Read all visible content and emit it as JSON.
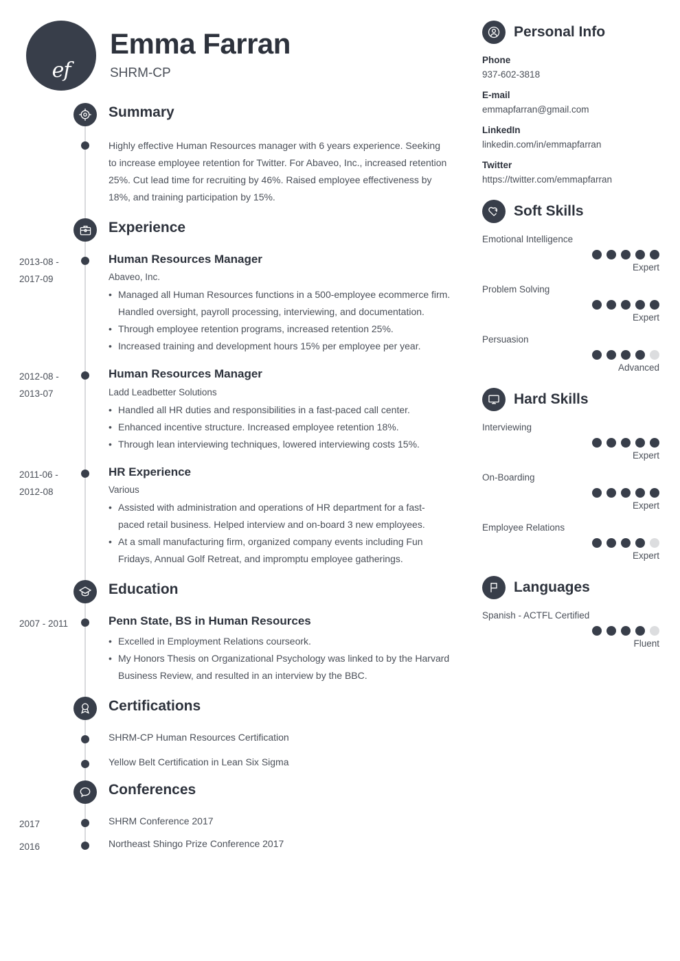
{
  "header": {
    "initials": "ef",
    "name": "Emma Farran",
    "subtitle": "SHRM-CP"
  },
  "sections": {
    "summary": {
      "title": "Summary",
      "icon": "target-icon",
      "text": "Highly effective Human Resources manager with 6 years experience. Seeking to increase employee retention for Twitter. For Abaveo, Inc., increased retention 25%. Cut lead time for recruiting by 46%. Raised employee effectiveness by 18%, and training participation by 15%."
    },
    "experience": {
      "title": "Experience",
      "icon": "briefcase-icon",
      "entries": [
        {
          "date": "2013-08 - 2017-09",
          "title": "Human Resources Manager",
          "org": "Abaveo, Inc.",
          "bullets": [
            "Managed all Human Resources functions in a 500-employee ecommerce firm. Handled oversight, payroll processing, interviewing, and documentation.",
            "Through employee retention programs, increased retention 25%.",
            "Increased training and development hours 15% per employee per year."
          ]
        },
        {
          "date": "2012-08 - 2013-07",
          "title": "Human Resources Manager",
          "org": "Ladd Leadbetter Solutions",
          "bullets": [
            "Handled all HR duties and responsibilities in a fast-paced call center.",
            "Enhanced incentive structure. Increased employee retention 18%.",
            "Through lean interviewing techniques, lowered interviewing costs 15%."
          ]
        },
        {
          "date": "2011-06 - 2012-08",
          "title": "HR Experience",
          "org": "Various",
          "bullets": [
            "Assisted with administration and operations of HR department for a fast-paced retail business. Helped interview and on-board 3 new employees.",
            "At a small manufacturing firm, organized company events including Fun Fridays, Annual Golf Retreat, and impromptu employee gatherings."
          ]
        }
      ]
    },
    "education": {
      "title": "Education",
      "icon": "graduation-cap-icon",
      "entries": [
        {
          "date": "2007 - 2011",
          "title": "Penn State, BS in Human Resources",
          "bullets": [
            "Excelled in Employment Relations courseork.",
            "My Honors Thesis on Organizational Psychology was linked to by the Harvard Business Review, and resulted in an interview by the BBC."
          ]
        }
      ]
    },
    "certifications": {
      "title": "Certifications",
      "icon": "award-ribbon-icon",
      "entries": [
        {
          "text": "SHRM-CP Human Resources Certification"
        },
        {
          "text": "Yellow Belt Certification in Lean Six Sigma"
        }
      ]
    },
    "conferences": {
      "title": "Conferences",
      "icon": "speech-bubble-icon",
      "entries": [
        {
          "date": "2017",
          "text": "SHRM Conference 2017"
        },
        {
          "date": "2016",
          "text": "Northeast Shingo Prize Conference 2017"
        }
      ]
    }
  },
  "sidebar": {
    "personal_info": {
      "title": "Personal Info",
      "icon": "person-icon",
      "items": [
        {
          "label": "Phone",
          "value": "937-602-3818"
        },
        {
          "label": "E-mail",
          "value": "emmapfarran@gmail.com"
        },
        {
          "label": "LinkedIn",
          "value": "linkedin.com/in/emmapfarran"
        },
        {
          "label": "Twitter",
          "value": "https://twitter.com/emmapfarran"
        }
      ]
    },
    "soft_skills": {
      "title": "Soft Skills",
      "icon": "heart-puzzle-icon",
      "items": [
        {
          "name": "Emotional Intelligence",
          "filled": 5,
          "total": 5,
          "level": "Expert"
        },
        {
          "name": "Problem Solving",
          "filled": 5,
          "total": 5,
          "level": "Expert"
        },
        {
          "name": "Persuasion",
          "filled": 4,
          "total": 5,
          "level": "Advanced"
        }
      ]
    },
    "hard_skills": {
      "title": "Hard Skills",
      "icon": "monitor-icon",
      "items": [
        {
          "name": "Interviewing",
          "filled": 5,
          "total": 5,
          "level": "Expert"
        },
        {
          "name": "On-Boarding",
          "filled": 5,
          "total": 5,
          "level": "Expert"
        },
        {
          "name": "Employee Relations",
          "filled": 4,
          "total": 5,
          "level": "Expert"
        }
      ]
    },
    "languages": {
      "title": "Languages",
      "icon": "flag-icon",
      "items": [
        {
          "name": "Spanish - ACTFL Certified",
          "filled": 4,
          "total": 5,
          "level": "Fluent"
        }
      ]
    }
  },
  "colors": {
    "accent": "#383e4a",
    "heading": "#2d323c",
    "body": "#4a4f58",
    "dot_off": "#dcdddf",
    "line": "#d9dadd"
  }
}
